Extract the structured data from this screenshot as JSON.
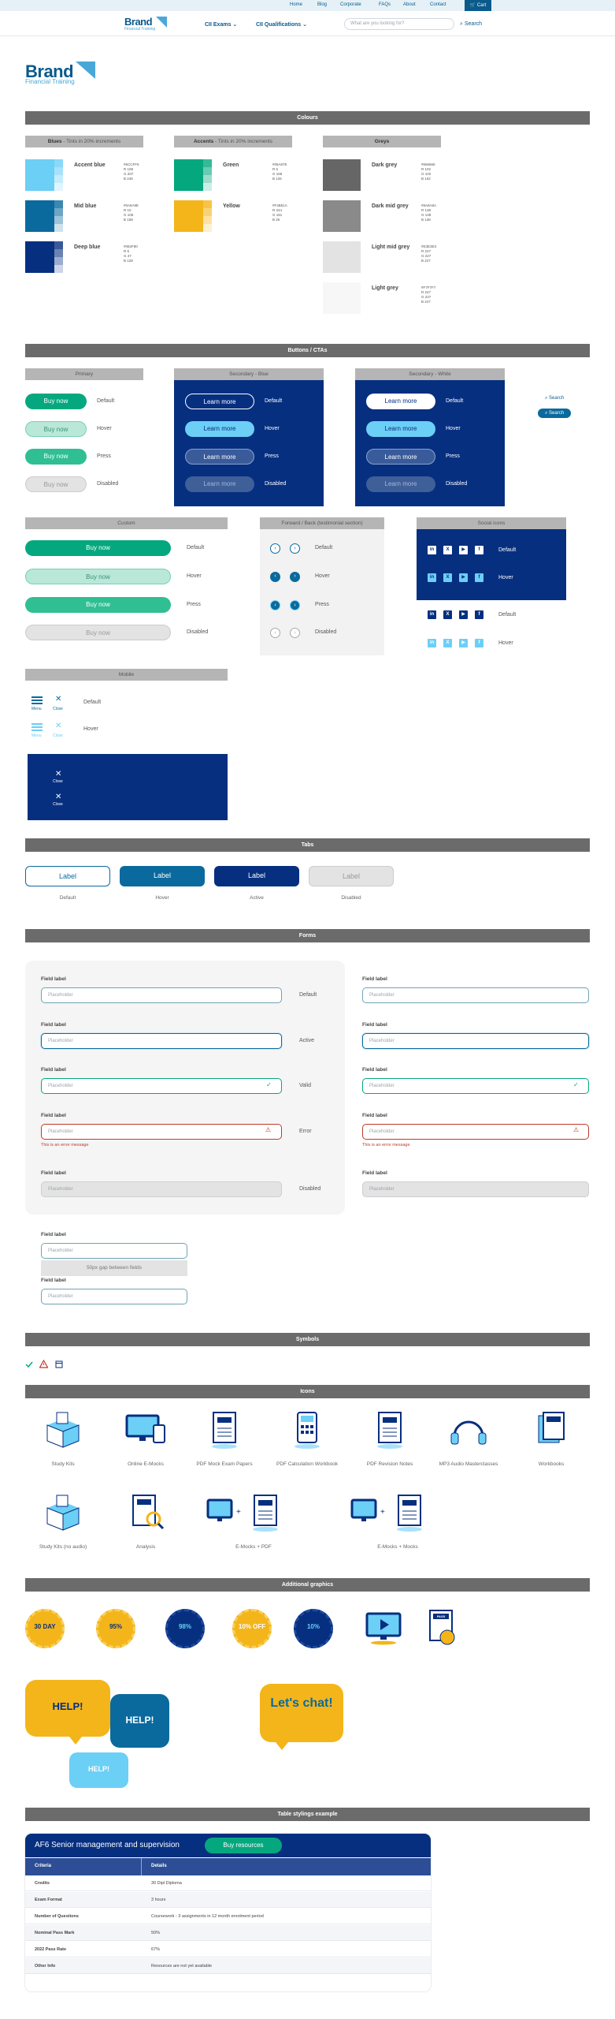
{
  "topbar": {
    "links": [
      "Home",
      "Blog",
      "Corporate",
      "FAQs",
      "About",
      "Contact"
    ],
    "cart_label": "Cart"
  },
  "nav": {
    "logo": "Brand",
    "logo_sub": "Financial Training",
    "items": [
      "CII Exams",
      "CII Qualifications"
    ],
    "search_placeholder": "What are you looking for?",
    "search_button": "Search"
  },
  "hero": {
    "logo": "Brand",
    "logo_sub": "Financial Training"
  },
  "colours": {
    "title": "Colours",
    "groups": [
      {
        "label": "Blues",
        "note": " - Tints in 20% increments",
        "swatches": [
          {
            "name": "Accent blue",
            "hex": "#6CCFF6",
            "r": "R 108",
            "g": "G 207",
            "b": "B 246",
            "color": "#6ccff6"
          },
          {
            "name": "Mid blue",
            "hex": "#0A6A9E",
            "r": "R 10",
            "g": "G 106",
            "b": "B 158",
            "color": "#0a6a9e"
          },
          {
            "name": "Deep blue",
            "hex": "#062F80",
            "r": "R 6",
            "g": "G 47",
            "b": "B 128",
            "color": "#062f80"
          }
        ]
      },
      {
        "label": "Accents",
        "note": " - Tints in 20% increments",
        "swatches": [
          {
            "name": "Green",
            "hex": "#05A87E",
            "r": "R 5",
            "g": "G 168",
            "b": "B 126",
            "color": "#05a87e"
          },
          {
            "name": "Yellow",
            "hex": "#F4B51A",
            "r": "R 244",
            "g": "G 181",
            "b": "B 26",
            "color": "#f4b51a"
          }
        ]
      },
      {
        "label": "Greys",
        "note": "",
        "swatches": [
          {
            "name": "Dark grey",
            "hex": "#666666",
            "r": "R 102",
            "g": "G 102",
            "b": "B 102",
            "color": "#666666"
          },
          {
            "name": "Dark mid grey",
            "hex": "#8A8A8A",
            "r": "R 138",
            "g": "G 138",
            "b": "B 138",
            "color": "#8a8a8a"
          },
          {
            "name": "Light mid grey",
            "hex": "#E3E3E3",
            "r": "R 227",
            "g": "G 227",
            "b": "B 227",
            "color": "#e3e3e3"
          },
          {
            "name": "Light grey",
            "hex": "#F7F7F7",
            "r": "R 247",
            "g": "G 247",
            "b": "B 247",
            "color": "#f7f7f7"
          }
        ]
      }
    ]
  },
  "buttons": {
    "title": "Buttons / CTAs",
    "primary_title": "Primary",
    "secondary_blue_title": "Secondary - Blue",
    "secondary_white_title": "Secondary - White",
    "custom_title": "Custom",
    "fwd_title": "Forward / Back (testimonial section)",
    "social_title": "Social icons",
    "mobile_title": "Mobile",
    "buy_now": "Buy now",
    "learn_more": "Learn more",
    "search": "Search",
    "menu": "Menu",
    "close": "Close",
    "states": [
      "Default",
      "Hover",
      "Press",
      "Disabled"
    ]
  },
  "tabs": {
    "title": "Tabs",
    "label": "Label",
    "captions": [
      "Default",
      "Hover",
      "Active",
      "Disabled"
    ]
  },
  "forms": {
    "title": "Forms",
    "field_label": "Field label",
    "placeholder": "Placeholder",
    "states": [
      "Default",
      "Active",
      "Valid",
      "Error",
      "Disabled"
    ],
    "error_message": "This is an error message",
    "gap_note": "50px gap between fields"
  },
  "symbols": {
    "title": "Symbols"
  },
  "icons": {
    "title": "Icons",
    "row1": [
      "Study Kits",
      "Online E-Mocks",
      "PDF Mock Exam Papers",
      "PDF Calculation Workbook",
      "PDF Revision Notes",
      "MP3 Audio Masterclasses",
      "Workbooks"
    ],
    "row2": [
      "Study Kits (no audio)",
      "Analysis",
      "E-Mocks + PDF",
      "E-Mocks + Mocks"
    ]
  },
  "graphics": {
    "title": "Additional graphics",
    "badges": [
      "30 DAY",
      "95%",
      "98%",
      "10% OFF",
      "10%"
    ],
    "help": "HELP!",
    "chat": "Let's chat!",
    "pass_label": "PASS"
  },
  "table_example": {
    "title": "Table stylings example",
    "heading": "AF6 Senior management and supervision",
    "cta": "Buy resources",
    "columns": [
      "Criteria",
      "Details"
    ],
    "rows": [
      [
        "Credits",
        "30 Dipl Diploma"
      ],
      [
        "Exam Format",
        "3 hours"
      ],
      [
        "Number of Questions",
        "Coursework - 3 assignments in 12 month enrolment period"
      ],
      [
        "Nominal Pass Mark",
        "50%"
      ],
      [
        "2022 Pass Rate",
        "67%"
      ],
      [
        "Other Info",
        "Resources are not yet available"
      ]
    ]
  },
  "colors": {
    "accent_blue": "#6ccff6",
    "mid_blue": "#0a6a9e",
    "deep_blue": "#062f80",
    "green": "#05a87e",
    "yellow": "#f4b51a",
    "error": "#c0392b"
  }
}
